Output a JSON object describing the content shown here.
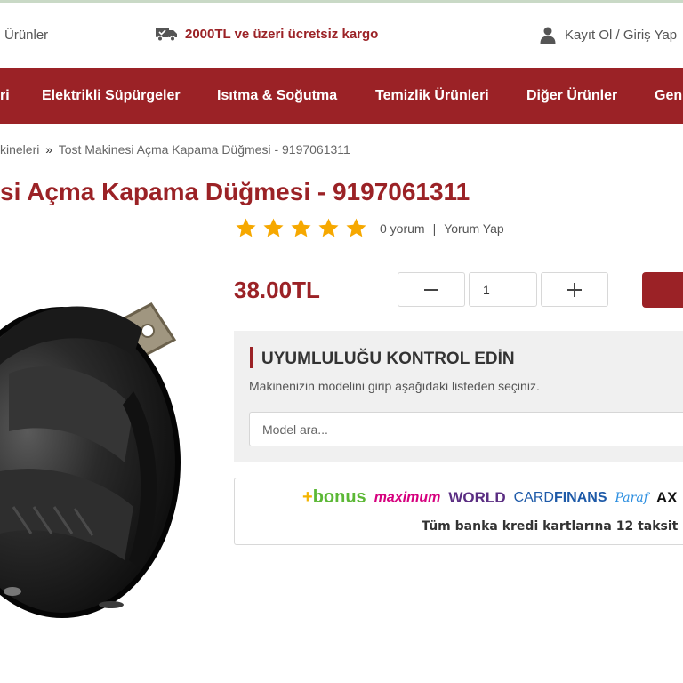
{
  "topbar": {
    "left_link": "Ürünler",
    "cargo_text": "2000TL ve üzeri ücretsiz kargo",
    "account_text": "Kayıt Ol / Giriş Yap",
    "accent_color": "#9b2226"
  },
  "nav": {
    "items": [
      {
        "label": "ri"
      },
      {
        "label": "Elektrikli Süpürgeler"
      },
      {
        "label": "Isıtma & Soğutma"
      },
      {
        "label": "Temizlik Ürünleri"
      },
      {
        "label": "Diğer Ürünler"
      },
      {
        "label": "Gen"
      }
    ]
  },
  "breadcrumb": {
    "prev": "kineleri",
    "separator": "»",
    "current": "Tost Makinesi Açma Kapama Düğmesi - 9197061311"
  },
  "product": {
    "title": "si Açma Kapama Düğmesi - 9197061311",
    "rating_stars": 5,
    "review_count": "0 yorum",
    "rating_separator": "|",
    "write_review": "Yorum Yap",
    "price": "38.00TL",
    "quantity": "1"
  },
  "compatibility": {
    "heading": "UYUMLULUĞU KONTROL EDİN",
    "description": "Makinenizin modelini girip aşağıdaki listeden seçiniz.",
    "search_placeholder": "Model ara..."
  },
  "installment": {
    "logos": {
      "bonus": "bonus",
      "maximum": "maximum",
      "world": "WORLD",
      "cardfinans_card": "CARD",
      "cardfinans_finans": "FINANS",
      "paraf": "Paraf",
      "axess": "AX"
    },
    "note": "Tüm banka kredi kartlarına 12 taksit"
  }
}
